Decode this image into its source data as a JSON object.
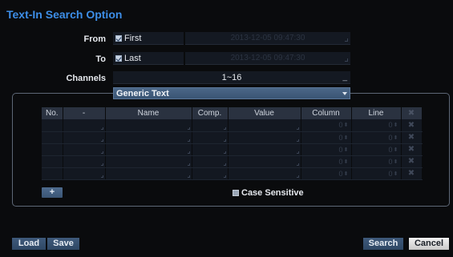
{
  "title": "Text-In Search Option",
  "from": {
    "label": "From",
    "option_label": "First",
    "checked": true,
    "datetime": "2013-12-05  09:47:30"
  },
  "to": {
    "label": "To",
    "option_label": "Last",
    "checked": true,
    "datetime": "2013-12-05  09:47:30"
  },
  "channels": {
    "label": "Channels",
    "value": "1~16",
    "suffix": "_"
  },
  "device_type": {
    "selected": "Generic Text"
  },
  "conditions_table": {
    "headers": [
      "No.",
      "-",
      "Name",
      "Comp.",
      "Value",
      "Column",
      "Line",
      "✖"
    ],
    "rows": [
      {
        "column": "0",
        "line": "0"
      },
      {
        "column": "0",
        "line": "0"
      },
      {
        "column": "0",
        "line": "0"
      },
      {
        "column": "0",
        "line": "0"
      },
      {
        "column": "0",
        "line": "0"
      }
    ],
    "delete_glyph": "✖",
    "spin_glyph": "⬍"
  },
  "add_button_label": "+",
  "case_sensitive": {
    "label": "Case Sensitive",
    "checked": false
  },
  "buttons": {
    "load": "Load",
    "save": "Save",
    "search": "Search",
    "cancel": "Cancel"
  },
  "colors": {
    "accent_title": "#3d8ee8",
    "button_blue": "#3f5a7b",
    "cancel_button": "#e2e2e2"
  }
}
